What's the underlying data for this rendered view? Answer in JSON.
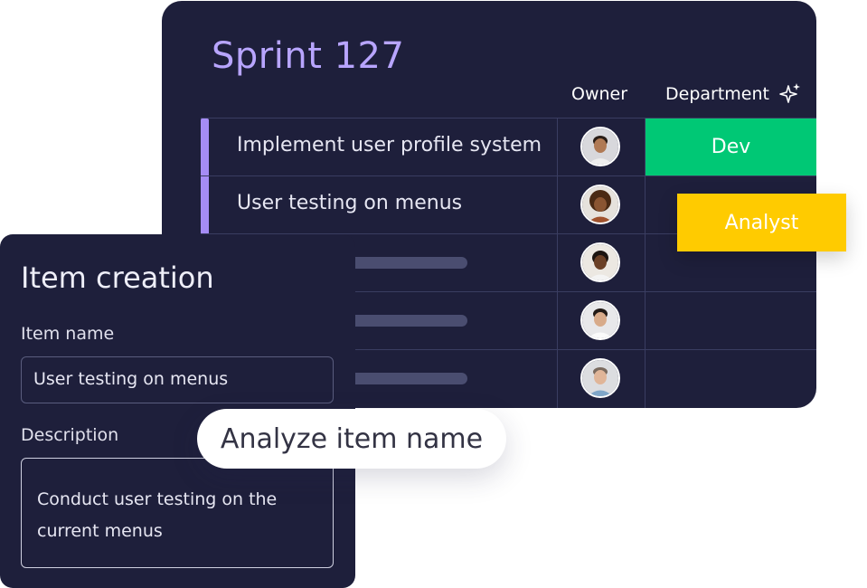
{
  "board": {
    "title": "Sprint 127",
    "columns": {
      "owner": "Owner",
      "department": "Department"
    },
    "rows": [
      {
        "name": "Implement user profile system",
        "department": "Dev"
      },
      {
        "name": "User testing on menus",
        "department": "Analyst"
      },
      {
        "name": ""
      },
      {
        "name": ""
      },
      {
        "name": ""
      }
    ]
  },
  "panel": {
    "title": "Item creation",
    "name_label": "Item name",
    "name_value": "User testing on menus",
    "description_label": "Description",
    "description_value": "Conduct user testing on the current menus"
  },
  "action": {
    "analyze_label": "Analyze item name"
  },
  "colors": {
    "board_bg": "#1e1f3b",
    "title_purple": "#b8a5ff",
    "dev_green": "#00c875",
    "analyst_yellow": "#ffcb00",
    "accent_purple": "#a58cf5"
  },
  "icons": {
    "sparkle": "sparkle-icon"
  }
}
